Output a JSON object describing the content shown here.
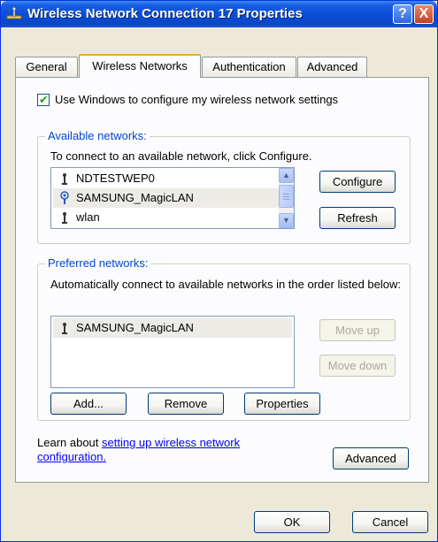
{
  "window": {
    "title": "Wireless Network Connection 17 Properties"
  },
  "titlebar_buttons": {
    "help": "?",
    "close": "X"
  },
  "tabs": [
    {
      "label": "General"
    },
    {
      "label": "Wireless Networks"
    },
    {
      "label": "Authentication"
    },
    {
      "label": "Advanced"
    }
  ],
  "checkbox": {
    "label": "Use Windows to configure my wireless network settings",
    "checked": true
  },
  "available": {
    "title": "Available networks:",
    "instruction": "To connect to an available network, click Configure.",
    "networks": [
      {
        "name": "NDTESTWEP0",
        "icon": "ap-icon"
      },
      {
        "name": "SAMSUNG_MagicLAN",
        "icon": "adhoc-icon"
      },
      {
        "name": "wlan",
        "icon": "ap-icon"
      }
    ],
    "configure_label": "Configure",
    "refresh_label": "Refresh"
  },
  "preferred": {
    "title": "Preferred networks:",
    "instruction": "Automatically connect to available networks in the order listed below:",
    "networks": [
      {
        "name": "SAMSUNG_MagicLAN",
        "icon": "ap-icon"
      }
    ],
    "move_up_label": "Move up",
    "move_down_label": "Move down",
    "add_label": "Add...",
    "remove_label": "Remove",
    "properties_label": "Properties"
  },
  "learn": {
    "prefix": "Learn about ",
    "link_line1": "setting up wireless network",
    "link_line2": "configuration."
  },
  "advanced_label": "Advanced",
  "ok_label": "OK",
  "cancel_label": "Cancel",
  "colors": {
    "accent": "#0046d5",
    "title_bar": "#0a4fd8",
    "dialog_bg": "#ece9d8"
  }
}
